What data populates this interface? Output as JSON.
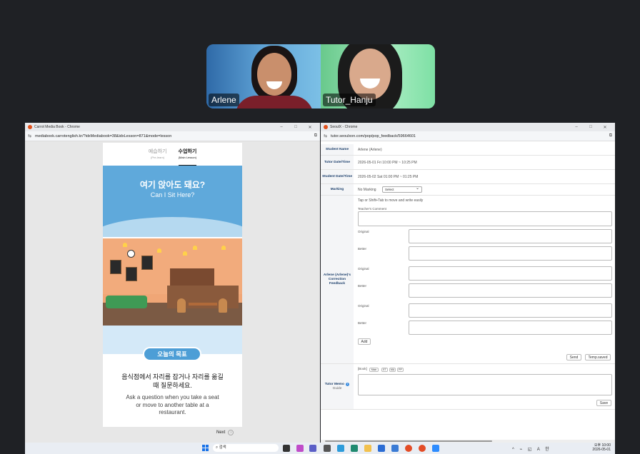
{
  "video": {
    "tiles": [
      {
        "name": "Arlene"
      },
      {
        "name": "Tutor_Hanju"
      }
    ]
  },
  "left_window": {
    "title": "Carrot Media Book - Chrome",
    "url": "mediabook.carrotenglish.kr/?idxMediabook=38&idxLesson=871&mode=lesson",
    "tabs": [
      {
        "label": "예습하기",
        "sub": "(Pre-learn)"
      },
      {
        "label": "수업하기",
        "sub": "(Main Lesson)",
        "active": true
      }
    ],
    "hero": {
      "ko": "여기 앉아도 돼요?",
      "en": "Can I Sit Here?"
    },
    "goal": {
      "pill": "오늘의 목표",
      "ko": "음식점에서 자리를 잡거나 자리를 옮길 때 질문하세요.",
      "en": "Ask a question when you take a seat or move to another table at a restaurant."
    },
    "next_label": "Next"
  },
  "right_window": {
    "title": "SeoulX - Chrome",
    "url": "tutor.seoulxon.com/pop/pop_feedback/59664601",
    "fields": {
      "student_name_label": "Student Name",
      "student_name": "Arlene (Arlene)",
      "tutor_dt_label": "Tutor Date/Time",
      "tutor_dt": "2026-05-01 Fri 10:00 PM ~ 10:25 PM",
      "student_dt_label": "Student Date/Time",
      "student_dt": "2026-05-02 Sat 01:00 PM ~ 01:25 PM",
      "marking_label": "Marking",
      "marking_value": "No Marking",
      "marking_select": "Select"
    },
    "feedback": {
      "label": "Arlene (Arlene)'s Correction Feedback",
      "hint": "Tap or Shift+Tab to move and write easily",
      "teacher_comment": "Teacher's Comment",
      "original": "Original",
      "better": "Better",
      "add": "Add",
      "send": "Send",
      "temp_saved": "Temp.saved"
    },
    "memo": {
      "label": "Tutor Memo",
      "guide": "Guide",
      "book_label": "[Book]",
      "chips": [
        "Main",
        "ET",
        "MA",
        "PP"
      ],
      "save": "Save"
    }
  },
  "taskbar": {
    "search_placeholder": "검색",
    "time": "오후 10:00",
    "date": "2026-05-01",
    "tray": "^ ⌁ ◱ A 한"
  },
  "colors": {
    "accent_blue": "#4d9ed6",
    "label_navy": "#1b3e6b",
    "taskbar_bg": "#e9edf3"
  }
}
